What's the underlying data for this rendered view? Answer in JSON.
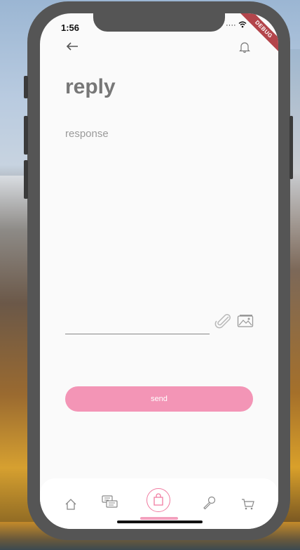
{
  "status": {
    "time": "1:56",
    "debug_banner": "DEBUG"
  },
  "header": {
    "back_icon": "arrow-left-icon",
    "bell_icon": "bell-icon"
  },
  "page": {
    "title": "reply"
  },
  "form": {
    "response_label": "response",
    "send_label": "send"
  },
  "tabbar": {
    "items": [
      "home-icon",
      "chat-icon",
      "shopping-bag-icon",
      "microphone-icon",
      "cart-icon"
    ],
    "active_index": 2
  },
  "colors": {
    "accent": "#f395b6",
    "title": "#777777",
    "placeholder": "#9a9a9a"
  }
}
